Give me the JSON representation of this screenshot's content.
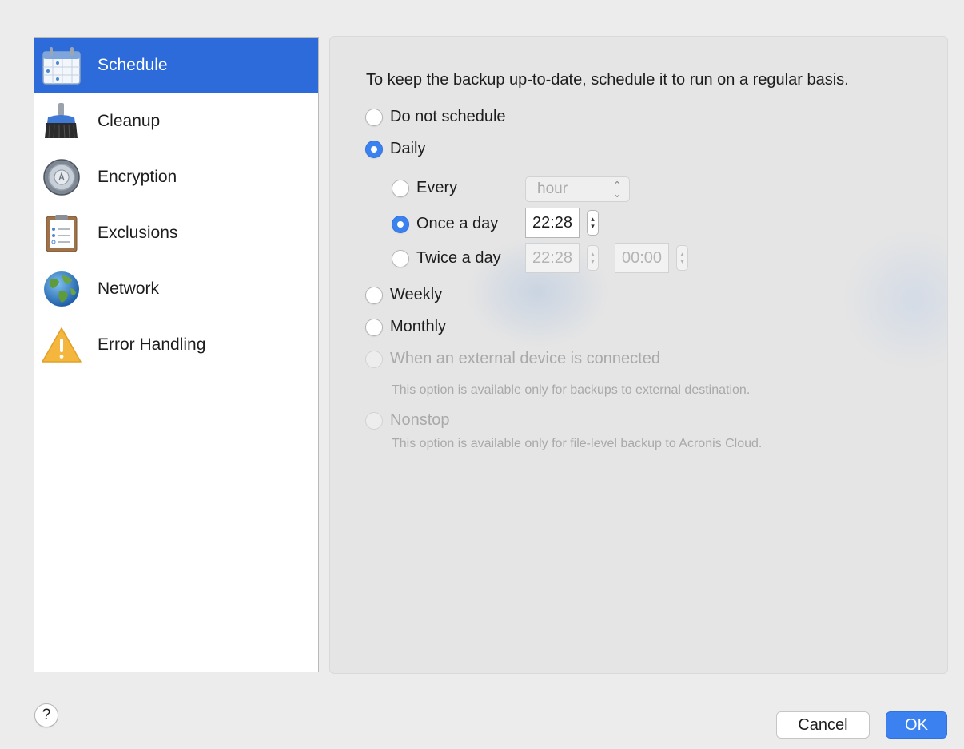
{
  "sidebar": {
    "items": [
      {
        "label": "Schedule",
        "icon": "calendar-icon",
        "selected": true
      },
      {
        "label": "Cleanup",
        "icon": "broom-icon",
        "selected": false
      },
      {
        "label": "Encryption",
        "icon": "lock-dial-icon",
        "selected": false
      },
      {
        "label": "Exclusions",
        "icon": "clipboard-list-icon",
        "selected": false
      },
      {
        "label": "Network",
        "icon": "globe-icon",
        "selected": false
      },
      {
        "label": "Error Handling",
        "icon": "warning-icon",
        "selected": false
      }
    ]
  },
  "schedule": {
    "intro": "To keep the backup up-to-date, schedule it to run on a regular basis.",
    "options": {
      "do_not_schedule": "Do not schedule",
      "daily": "Daily",
      "every": "Every",
      "once_a_day": "Once a day",
      "twice_a_day": "Twice a day",
      "weekly": "Weekly",
      "monthly": "Monthly",
      "external_device": "When an external device is connected",
      "nonstop": "Nonstop"
    },
    "selected_option": "daily",
    "selected_daily_option": "once_a_day",
    "every_unit": "hour",
    "once_time": "22:28",
    "twice_time_1": "22:28",
    "twice_time_2": "00:00",
    "external_note": "This option is available only for backups to external destination.",
    "nonstop_note": "This option is available only for file-level backup to Acronis Cloud."
  },
  "footer": {
    "help_label": "?",
    "cancel_label": "Cancel",
    "ok_label": "OK"
  },
  "colors": {
    "accent": "#3b82f0",
    "selection": "#2c6bd9",
    "disabled_text": "#a9a9a9"
  }
}
